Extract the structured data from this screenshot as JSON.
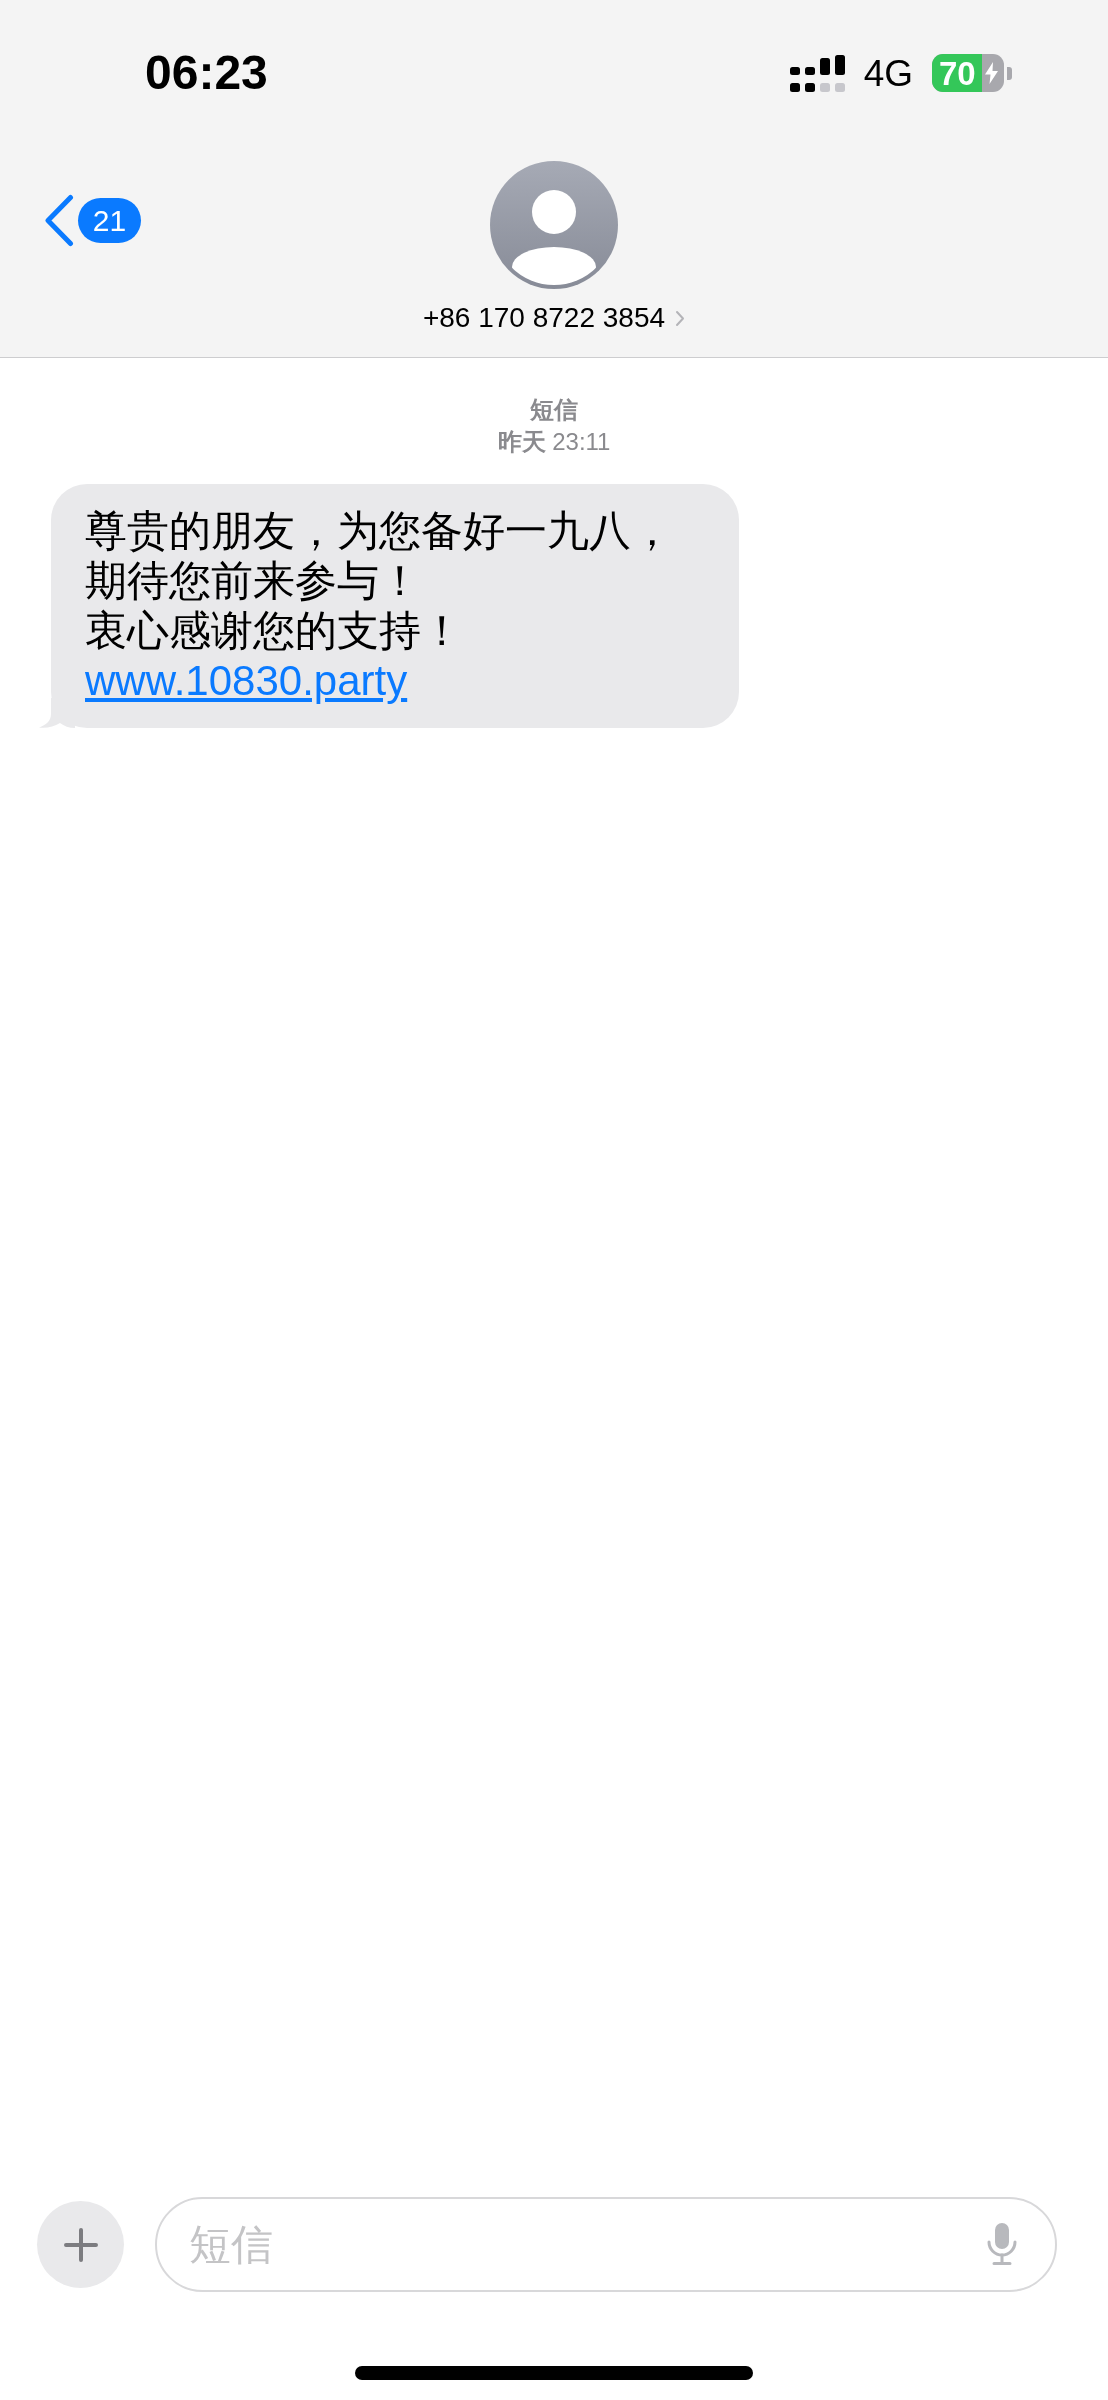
{
  "status_bar": {
    "time": "06:23",
    "network": "4G",
    "battery": {
      "percent": "70",
      "level": 0.7,
      "charging": true
    }
  },
  "nav": {
    "back_badge": "21",
    "contact": "+86 170 8722 3854"
  },
  "conversation": {
    "service": "短信",
    "timestamp": "**昨天** 23:11",
    "messages": [
      {
        "kind": "incoming",
        "paragraphs": [
          "尊贵的朋友，为您备好一九八，期待您前来参与！",
          "衷心感谢您的支持！"
        ],
        "link": "www.10830.party"
      }
    ]
  },
  "composer": {
    "placeholder": "短信"
  }
}
